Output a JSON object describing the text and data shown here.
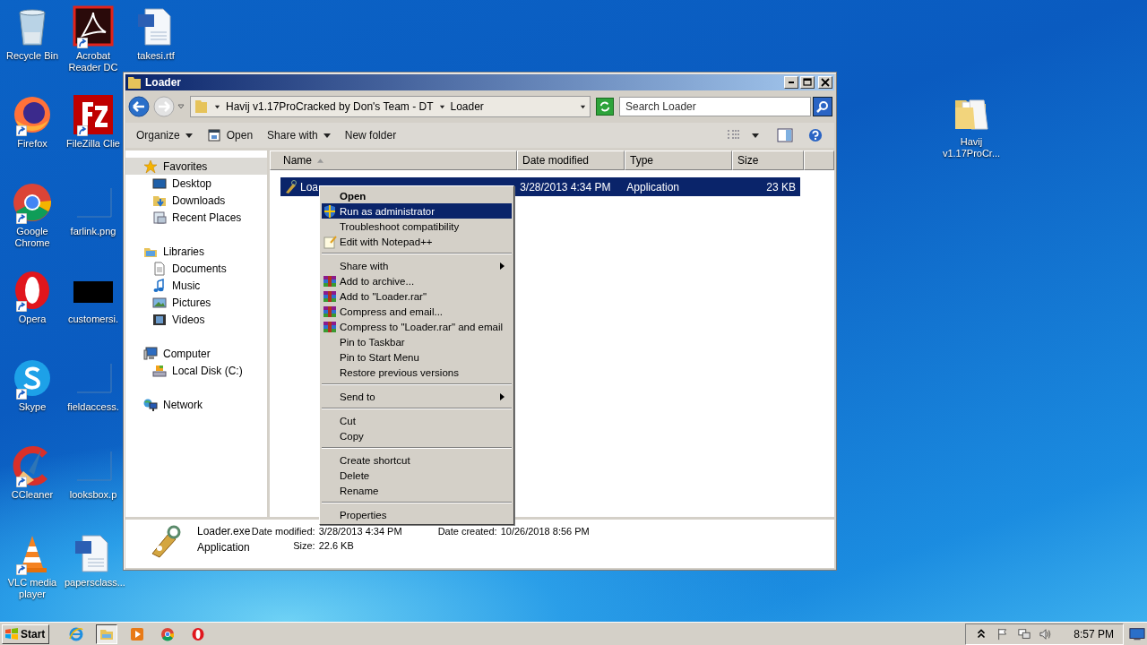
{
  "desktop_icons": [
    {
      "label": "Recycle Bin",
      "kind": "bin",
      "shortcut": false
    },
    {
      "label": "Firefox",
      "kind": "fox",
      "shortcut": true
    },
    {
      "label": "Google Chrome",
      "kind": "chrome",
      "shortcut": true
    },
    {
      "label": "Opera",
      "kind": "opera",
      "shortcut": true
    },
    {
      "label": "Skype",
      "kind": "skype",
      "shortcut": true
    },
    {
      "label": "CCleaner",
      "kind": "cleaner",
      "shortcut": true
    },
    {
      "label": "VLC media player",
      "kind": "cone",
      "shortcut": true
    },
    {
      "label": "Acrobat Reader DC",
      "kind": "pdf",
      "shortcut": true
    },
    {
      "label": "FileZilla Clie",
      "kind": "ftp",
      "shortcut": true
    },
    {
      "label": "farlink.png",
      "kind": "image",
      "shortcut": false
    },
    {
      "label": "customersi.",
      "kind": "blackimage",
      "shortcut": false
    },
    {
      "label": "fieldaccess.",
      "kind": "image",
      "shortcut": false
    },
    {
      "label": "looksbox.p",
      "kind": "image",
      "shortcut": false
    },
    {
      "label": "papersclass...",
      "kind": "doc",
      "shortcut": false
    },
    {
      "label": "takesi.rtf",
      "kind": "doc",
      "shortcut": false
    }
  ],
  "desktop_icon_right": {
    "label": "Havij v1.17ProCr...",
    "kind": "folder",
    "shortcut": false
  },
  "window": {
    "title": "Loader",
    "address": [
      "Havij v1.17ProCracked by Don's Team - DT",
      "Loader"
    ],
    "search": {
      "placeholder": "Search Loader"
    },
    "toolbar": [
      {
        "label": "Organize",
        "kind": "menu"
      },
      {
        "label": "Open",
        "kind": "action"
      },
      {
        "label": "Share with",
        "kind": "menu"
      },
      {
        "label": "New folder",
        "kind": "plain"
      }
    ],
    "nav": [
      {
        "label": "Favorites",
        "kind": "star",
        "selected": true,
        "children": [
          {
            "label": "Desktop",
            "kind": "desktop",
            "selected": false
          },
          {
            "label": "Downloads",
            "kind": "downloads",
            "selected": false
          },
          {
            "label": "Recent Places",
            "kind": "recent",
            "selected": false
          }
        ]
      },
      {
        "label": "Libraries",
        "kind": "library",
        "selected": false,
        "children": [
          {
            "label": "Documents",
            "kind": "documents",
            "selected": false
          },
          {
            "label": "Music",
            "kind": "music",
            "selected": false
          },
          {
            "label": "Pictures",
            "kind": "pictures",
            "selected": false
          },
          {
            "label": "Videos",
            "kind": "videos",
            "selected": false
          }
        ]
      },
      {
        "label": "Computer",
        "kind": "computer",
        "selected": false,
        "children": [
          {
            "label": "Local Disk (C:)",
            "kind": "disk",
            "selected": false
          }
        ]
      },
      {
        "label": "Network",
        "kind": "network",
        "selected": false
      }
    ],
    "columns": [
      {
        "label": "Name",
        "sorted": true
      },
      {
        "label": "Date modified",
        "sorted": false
      },
      {
        "label": "Type",
        "sorted": false
      },
      {
        "label": "Size",
        "sorted": false
      }
    ],
    "rows": [
      {
        "name": "Loa",
        "date": "3/28/2013 4:34 PM",
        "type": "Application",
        "size": "23 KB",
        "selected": true
      }
    ],
    "details": {
      "name": "Loader.exe",
      "type": "Application",
      "fields": [
        {
          "label": "Date modified:",
          "value": "3/28/2013 4:34 PM"
        },
        {
          "label": "Size:",
          "value": "22.6 KB"
        },
        {
          "label": "Date created:",
          "value": "10/26/2018 8:56 PM"
        }
      ]
    }
  },
  "context_menu": [
    [
      {
        "label": "Open",
        "default": true,
        "selected": false,
        "submenu": false
      },
      {
        "label": "Run as administrator",
        "kind": "shield",
        "default": false,
        "selected": true,
        "submenu": false
      },
      {
        "label": "Troubleshoot compatibility",
        "default": false,
        "selected": false,
        "submenu": false
      },
      {
        "label": "Edit with Notepad++",
        "kind": "notepad",
        "default": false,
        "selected": false,
        "submenu": false
      }
    ],
    [
      {
        "label": "Share with",
        "default": false,
        "selected": false,
        "submenu": true
      },
      {
        "label": "Add to archive...",
        "kind": "rar",
        "default": false,
        "selected": false,
        "submenu": false
      },
      {
        "label": "Add to \"Loader.rar\"",
        "kind": "rar",
        "default": false,
        "selected": false,
        "submenu": false
      },
      {
        "label": "Compress and email...",
        "kind": "rar",
        "default": false,
        "selected": false,
        "submenu": false
      },
      {
        "label": "Compress to \"Loader.rar\" and email",
        "kind": "rar",
        "default": false,
        "selected": false,
        "submenu": false
      },
      {
        "label": "Pin to Taskbar",
        "default": false,
        "selected": false,
        "submenu": false
      },
      {
        "label": "Pin to Start Menu",
        "default": false,
        "selected": false,
        "submenu": false
      },
      {
        "label": "Restore previous versions",
        "default": false,
        "selected": false,
        "submenu": false
      }
    ],
    [
      {
        "label": "Send to",
        "default": false,
        "selected": false,
        "submenu": true
      }
    ],
    [
      {
        "label": "Cut",
        "default": false,
        "selected": false,
        "submenu": false
      },
      {
        "label": "Copy",
        "default": false,
        "selected": false,
        "submenu": false
      }
    ],
    [
      {
        "label": "Create shortcut",
        "default": false,
        "selected": false,
        "submenu": false
      },
      {
        "label": "Delete",
        "default": false,
        "selected": false,
        "submenu": false
      },
      {
        "label": "Rename",
        "default": false,
        "selected": false,
        "submenu": false
      }
    ],
    [
      {
        "label": "Properties",
        "default": false,
        "selected": false,
        "submenu": false
      }
    ]
  ],
  "taskbar": {
    "start": "Start",
    "apps": [
      {
        "kind": "ie",
        "selected": false
      },
      {
        "kind": "explorer",
        "selected": true
      },
      {
        "kind": "media",
        "selected": false
      },
      {
        "kind": "chrome",
        "selected": false
      },
      {
        "kind": "opera",
        "selected": false
      }
    ],
    "time": "8:57 PM"
  }
}
